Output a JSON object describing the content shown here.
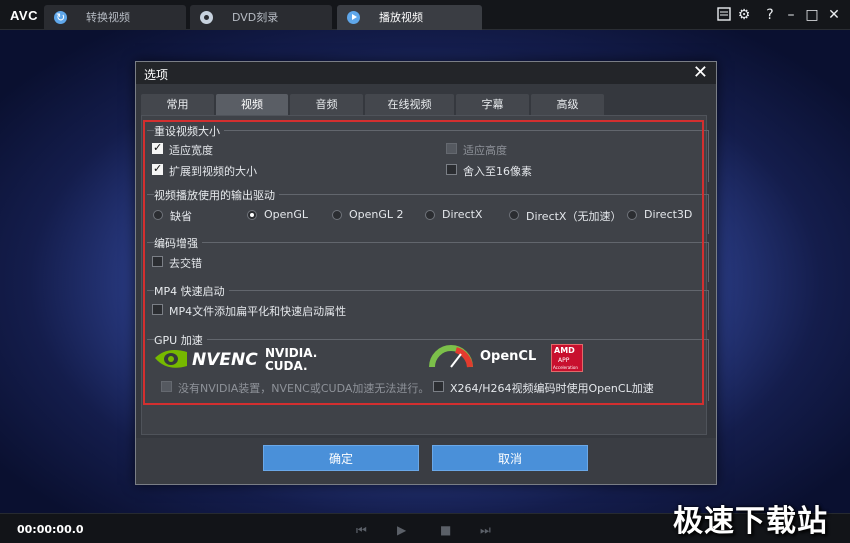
{
  "app": {
    "logo": "AVC"
  },
  "tabs": [
    {
      "label": "转换视频",
      "icon": "convert-icon"
    },
    {
      "label": "DVD刻录",
      "icon": "disc-icon"
    },
    {
      "label": "播放视频",
      "icon": "play-icon"
    }
  ],
  "window_controls": {
    "settings": "⚙",
    "help": "?",
    "minimize": "–",
    "maximize": "□",
    "close": "✕"
  },
  "dialog": {
    "title": "选项",
    "close": "✕",
    "tabs": [
      "常用",
      "视频",
      "音频",
      "在线视频",
      "字幕",
      "高级"
    ],
    "active_tab": "视频",
    "groups": {
      "resize": {
        "title": "重设视频大小",
        "options": [
          {
            "label": "适应宽度",
            "checked": true,
            "enabled": true
          },
          {
            "label": "扩展到视频的大小",
            "checked": true,
            "enabled": true
          },
          {
            "label": "适应高度",
            "checked": false,
            "enabled": false
          },
          {
            "label": "舍入至16像素",
            "checked": false,
            "enabled": true
          }
        ]
      },
      "renderer": {
        "title": "视频播放使用的输出驱动",
        "options": [
          "缺省",
          "OpenGL",
          "OpenGL 2",
          "DirectX",
          "DirectX（无加速）",
          "Direct3D"
        ],
        "selected": "OpenGL"
      },
      "enhance": {
        "title": "编码增强",
        "options": [
          {
            "label": "去交错",
            "checked": false
          }
        ]
      },
      "mp4": {
        "title": "MP4 快速启动",
        "options": [
          {
            "label": "MP4文件添加扁平化和快速启动属性",
            "checked": false
          }
        ]
      },
      "gpu": {
        "title": "GPU 加速",
        "nvenc": "NVENC",
        "nvidia": "NVIDIA.",
        "cuda": "CUDA.",
        "opencl": "OpenCL",
        "amd": "AMD",
        "amd_sub": "APP",
        "amd_sub2": "Acceleration",
        "nvidia_note": "没有NVIDIA装置，NVENC或CUDA加速无法进行。",
        "opencl_option": "X264/H264视频编码时使用OpenCL加速",
        "colors": {
          "nvidia_green": "#76b900",
          "amd_red": "#c8102e"
        }
      }
    },
    "ok_label": "确定",
    "cancel_label": "取消",
    "accent_color": "#4a90d9",
    "highlight_color": "#d32f2f"
  },
  "player": {
    "time": "00:00:00.0",
    "controls": [
      "prev-icon",
      "play-icon",
      "stop-icon",
      "next-icon"
    ]
  },
  "watermark": "极速下载站"
}
